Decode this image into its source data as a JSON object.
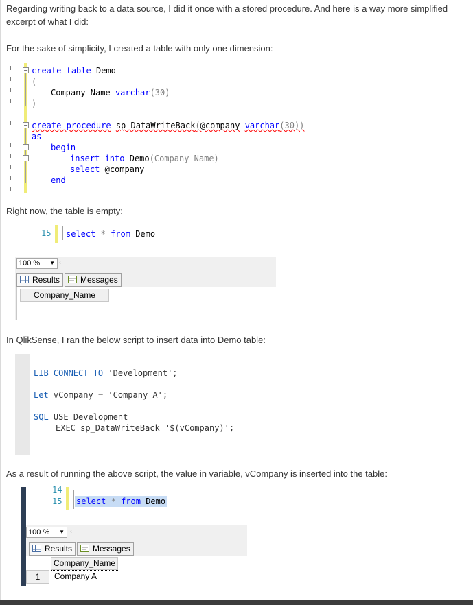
{
  "paragraphs": {
    "intro_line1": "Regarding writing back to a data source, I did it once with a stored procedure. And here is a way more simplified",
    "intro_line2": "excerpt of what I did:",
    "simplicity": "For the sake of simplicity, I created a table with only one dimension:",
    "empty": "Right now, the table is empty:",
    "qliksense": "In QlikSense, I ran the below script to insert data into Demo table:",
    "result": "As a result of running the above script, the value in variable, vCompany is inserted into the table:"
  },
  "sql_code": {
    "create_kw": "create",
    "table_kw": "table",
    "table_name": "Demo",
    "open_paren": "(",
    "col_name": "Company_Name",
    "col_type": "varchar",
    "col_len": "(30)",
    "close_paren": ")",
    "create_proc_kw": "create procedure",
    "proc_name": "sp_DataWriteBack",
    "param_open": "(",
    "param_name": "@company",
    "param_type": "varchar",
    "param_len": "(30))",
    "as_kw": "as",
    "begin_kw": "begin",
    "insert_kw": "insert into",
    "insert_target": "Demo",
    "insert_cols": "(Company_Name)",
    "select_kw": "select",
    "select_var": "@company",
    "end_kw": "end"
  },
  "query1": {
    "line_no": "15",
    "select_kw": "select",
    "star": "*",
    "from_kw": "from",
    "table": "Demo",
    "zoom": "100 %",
    "tab_results": "Results",
    "tab_messages": "Messages",
    "column": "Company_Name"
  },
  "qlik_script": {
    "lib": "LIB CONNECT TO",
    "lib_arg": "'Development';",
    "let": "Let",
    "let_rest": "vCompany = 'Company A';",
    "sql": "SQL",
    "sql_rest": "USE Development",
    "exec_line": "EXEC sp_DataWriteBack '$(vCompany)';"
  },
  "query2": {
    "line_no_a": "14",
    "line_no_b": "15",
    "select_kw": "select",
    "star": "*",
    "from_kw": "from",
    "table": "Demo",
    "zoom": "100 %",
    "tab_results": "Results",
    "tab_messages": "Messages",
    "column": "Company_Name",
    "row_number": "1",
    "row_value": "Company A"
  },
  "colors": {
    "keyword": "#0000ff",
    "line_number": "#2b91af",
    "change_bar": "#f0ec78",
    "string": "#ff0000"
  }
}
